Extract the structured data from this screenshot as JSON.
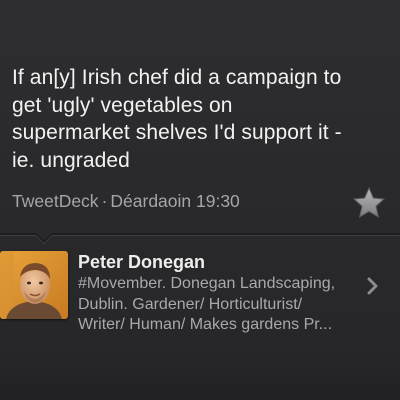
{
  "tweet": {
    "text": "If an[y] Irish chef did a campaign to\nget 'ugly' vegetables on\nsupermarket shelves I'd support it -\nie. ungraded",
    "source": "TweetDeck",
    "separator": "·",
    "timestamp": "Déardaoin 19:30"
  },
  "actions": {
    "favorite_icon": "star-icon"
  },
  "author": {
    "name": "Peter Donegan",
    "bio": "#Movember. Donegan Landscaping,\nDublin. Gardener/ Horticulturist/\nWriter/ Human/ Makes gardens Pr...",
    "avatar_icon": "avatar-photo",
    "disclosure_icon": "chevron-right-icon"
  },
  "colors": {
    "background": "#2a2a2c",
    "text_primary": "#f2f2f2",
    "text_secondary": "#a6a6a8"
  }
}
